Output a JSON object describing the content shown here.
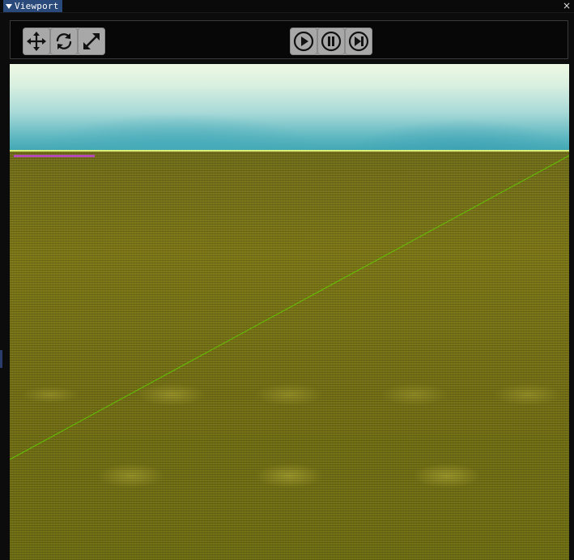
{
  "window": {
    "title": "Viewport",
    "close_symbol": "×"
  },
  "toolbar": {
    "transform_tools": [
      {
        "name": "move",
        "icon": "move-icon"
      },
      {
        "name": "rotate",
        "icon": "rotate-icon"
      },
      {
        "name": "scale",
        "icon": "scale-icon"
      }
    ],
    "playback_controls": [
      {
        "name": "play",
        "icon": "play-icon"
      },
      {
        "name": "pause",
        "icon": "pause-icon"
      },
      {
        "name": "step",
        "icon": "step-forward-icon"
      }
    ]
  },
  "colors": {
    "title_tab": "#294a7a",
    "button_bg": "#a8a8a8",
    "sky_top": "#eef8e2",
    "sky_bottom": "#3fa6b2",
    "ground": "#6e6a18",
    "horizon": "#d9ef7a",
    "axis_line": "#5fd000",
    "magenta_marker": "#b44ab8"
  }
}
